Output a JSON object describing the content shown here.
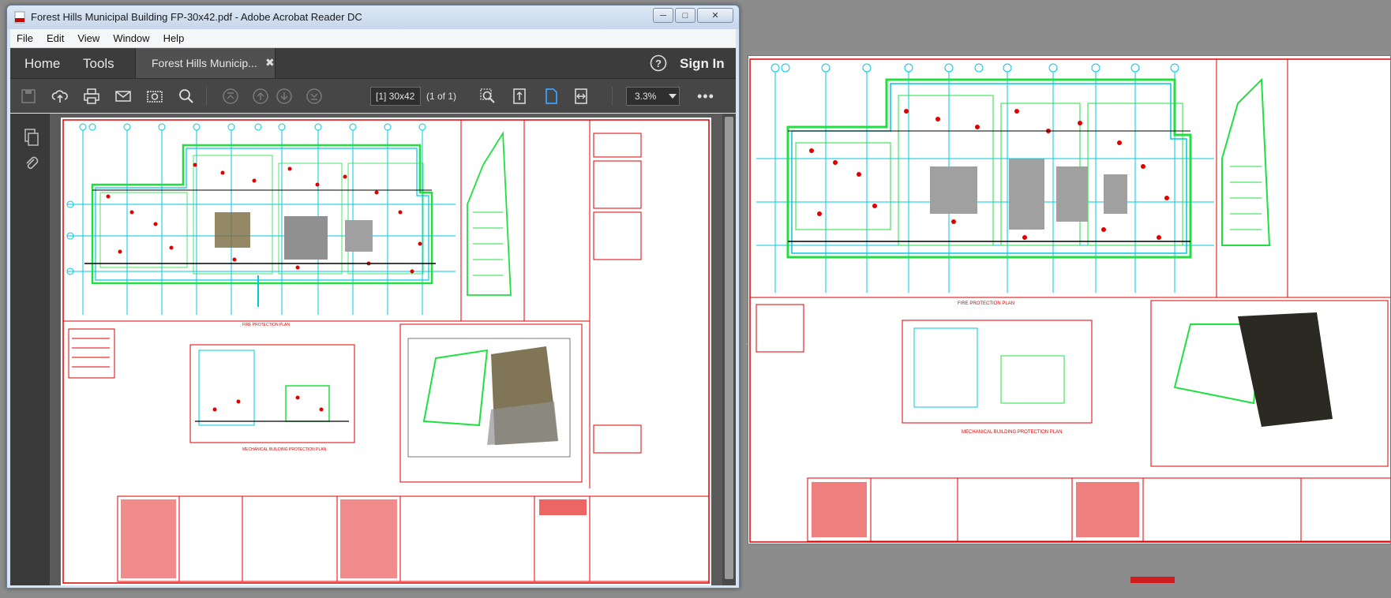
{
  "window": {
    "title": "Forest Hills Municipal Building FP-30x42.pdf - Adobe Acrobat Reader DC",
    "minimize": "─",
    "maximize": "□",
    "close": "✕"
  },
  "menu": [
    "File",
    "Edit",
    "View",
    "Window",
    "Help"
  ],
  "tabs": {
    "home": "Home",
    "tools": "Tools",
    "document": "Forest Hills Municip...",
    "document_close": "✖",
    "sign_in": "Sign In"
  },
  "toolbar": {
    "page_field": "[1] 30x42",
    "page_count": "(1 of 1)",
    "zoom": "3.3%",
    "more": "•••",
    "icons": [
      "save-icon",
      "cloud-upload-icon",
      "print-icon",
      "email-icon",
      "snapshot-icon",
      "search-icon",
      "first-page-icon",
      "previous-page-icon",
      "next-page-icon",
      "last-page-icon",
      "marquee-zoom-icon",
      "scrolling-mode-icon",
      "single-page-icon",
      "fit-width-icon"
    ]
  },
  "left_pane": {
    "icons": [
      "pages-icon",
      "attachments-icon"
    ]
  },
  "colors": {
    "drawing_red": "#e00000",
    "drawing_cyan": "#00c8e0",
    "drawing_green": "#20e040",
    "dark_chrome": "#3c3c3c",
    "accent_blue": "#3aa0ff"
  }
}
